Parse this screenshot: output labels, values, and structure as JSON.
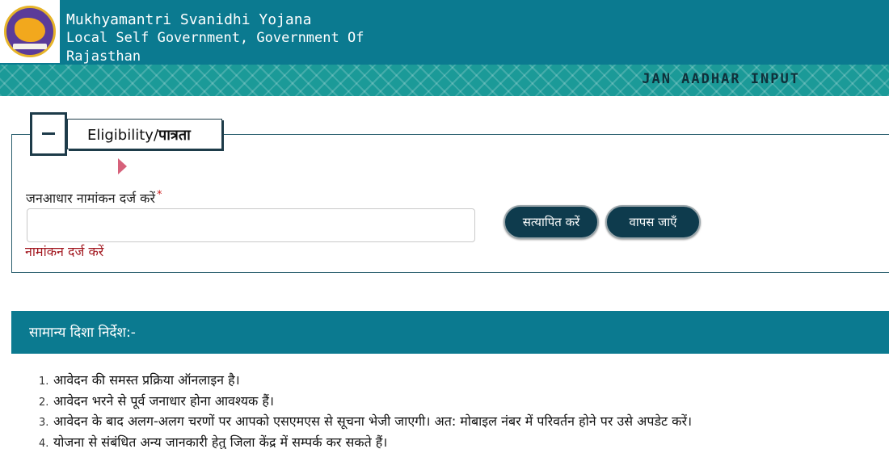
{
  "header": {
    "title_line1": "Mukhyamantri Svanidhi Yojana",
    "title_line2": "Local Self Government, Government Of",
    "title_line3": "Rajasthan",
    "section_label": "JAN AADHAR INPUT"
  },
  "eligibility": {
    "toggle_symbol": "–",
    "legend_en": "Eligibility/",
    "legend_hi": "पात्रता",
    "field_label": "जनआधार नामांकन दर्ज करें",
    "required_mark": "*",
    "input_value": "",
    "hint": "नामांकन दर्ज करें",
    "verify_button": "सत्यापित करें",
    "back_button": "वापस जाएँ"
  },
  "instructions": {
    "title": "सामान्य दिशा निर्देश:-",
    "items": [
      {
        "num": "1.",
        "text": "आवेदन की समस्त प्रक्रिया ऑनलाइन है।"
      },
      {
        "num": "2.",
        "text": "आवेदन भरने से पूर्व जनाधार होना आवश्यक हैं।"
      },
      {
        "num": "3.",
        "text": "आवेदन के बाद अलग-अलग चरणों पर आपको एसएमएस से सूचना भेजी जाएगी। अत: मोबाइल नंबर में परिवर्तन होने पर उसे अपडेट करें।"
      },
      {
        "num": "4.",
        "text": "योजना से संबंधित अन्य जानकारी हेतु जिला केंद्र में सम्पर्क कर सकते हैं।"
      }
    ]
  },
  "colors": {
    "header_bg": "#0b7a90",
    "band_bg": "#1b9a98",
    "button_bg": "#0e3b4d",
    "hint_text": "#a2171f"
  },
  "icons": {
    "logo": "government-emblem-logo",
    "toggle": "collapse-minus-icon",
    "pointer": "triangle-pointer-icon"
  }
}
